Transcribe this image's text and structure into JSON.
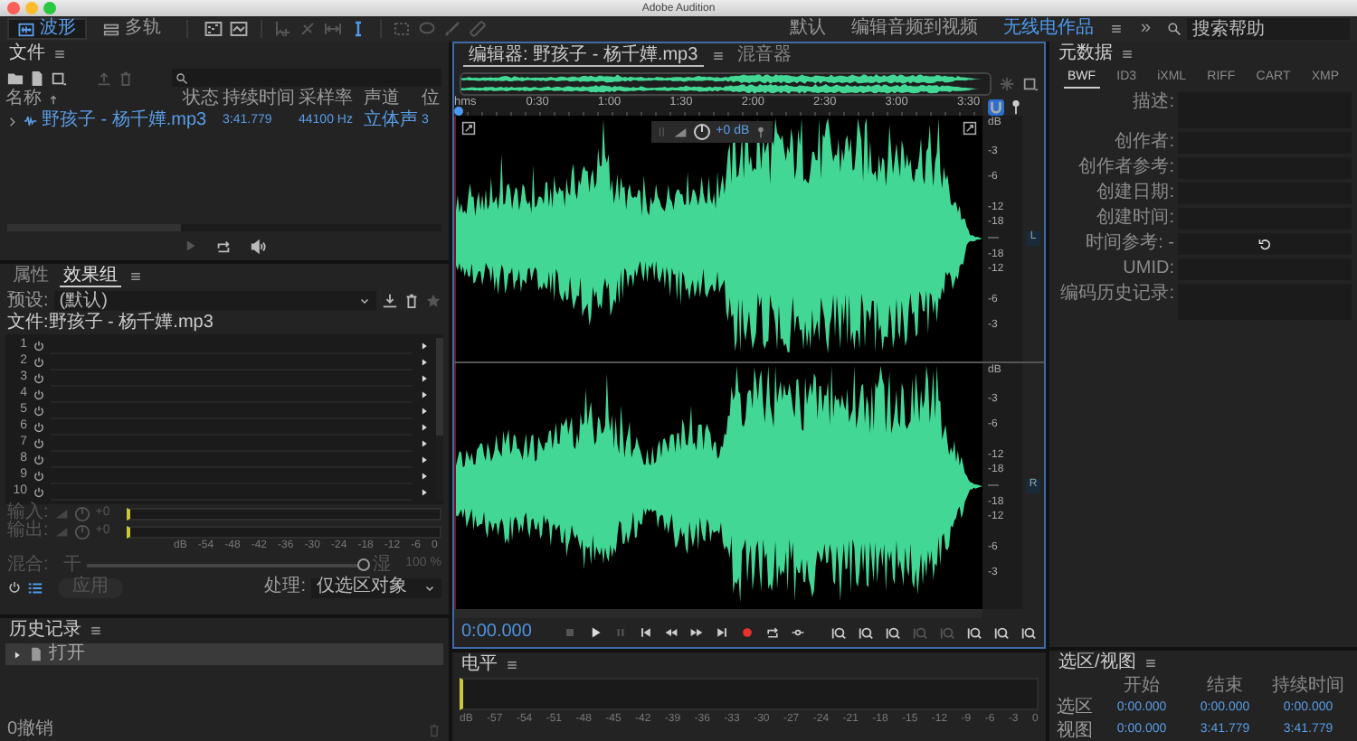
{
  "window": {
    "title": "Adobe Audition"
  },
  "toolbar": {
    "views": [
      {
        "label": "波形",
        "kind": "waveform",
        "selected": true
      },
      {
        "label": "多轨",
        "kind": "multitrack",
        "selected": false
      }
    ],
    "tools": [
      {
        "kind": "spectral",
        "selected": false,
        "disabled": false
      },
      {
        "kind": "pitch",
        "selected": false,
        "disabled": false
      },
      {
        "kind": "move",
        "selected": false,
        "disabled": true
      },
      {
        "kind": "razor",
        "selected": false,
        "disabled": true
      },
      {
        "kind": "slip",
        "selected": false,
        "disabled": true
      },
      {
        "kind": "time",
        "selected": true,
        "disabled": false
      },
      {
        "kind": "marquee",
        "selected": false,
        "disabled": true
      },
      {
        "kind": "lasso",
        "selected": false,
        "disabled": true
      },
      {
        "kind": "brush",
        "selected": false,
        "disabled": true
      },
      {
        "kind": "healing",
        "selected": false,
        "disabled": true
      }
    ],
    "workspaces": [
      {
        "label": "默认",
        "selected": false
      },
      {
        "label": "编辑音频到视频",
        "selected": false
      },
      {
        "label": "无线电作品",
        "selected": true
      }
    ],
    "overflow": "»",
    "search": {
      "placeholder": "搜索帮助"
    }
  },
  "files_panel": {
    "title": "文件",
    "columns": [
      "名称",
      "状态",
      "持续时间",
      "采样率",
      "声道",
      "位"
    ],
    "rows": [
      {
        "name": "野孩子 - 杨千嬅.mp3",
        "duration": "3:41.779",
        "sample_rate": "44100 Hz",
        "channels": "立体声",
        "column_6": "3"
      }
    ]
  },
  "effects_panel": {
    "tabs": [
      {
        "label": "属性",
        "selected": false
      },
      {
        "label": "效果组",
        "selected": true
      }
    ],
    "preset_label": "预设:",
    "preset": "(默认)",
    "file_label": "文件:野孩子 - 杨千嬅.mp3",
    "slots": [
      "1",
      "2",
      "3",
      "4",
      "5",
      "6",
      "7",
      "8",
      "9",
      "10"
    ],
    "io": [
      {
        "label": "输入:",
        "value": "+0"
      },
      {
        "label": "输出:",
        "value": "+0"
      }
    ],
    "meter_scale": [
      "dB",
      "-54",
      "-48",
      "-42",
      "-36",
      "-30",
      "-24",
      "-18",
      "-12",
      "-6",
      "0"
    ],
    "mix": {
      "label": "混合:",
      "dry": "干",
      "wet": "湿",
      "level": 1,
      "reading": "100 %"
    },
    "apply": "应用",
    "process_label": "处理:",
    "process": "仅选区对象"
  },
  "history_panel": {
    "title": "历史记录",
    "items": [
      {
        "label": "打开",
        "selected": true
      }
    ],
    "status": "0撤销"
  },
  "editor": {
    "tabs": [
      {
        "label": "编辑器: 野孩子 - 杨千嬅.mp3",
        "selected": true
      },
      {
        "label": "混音器",
        "selected": false
      }
    ],
    "ruler": [
      "hms",
      "0:30",
      "1:00",
      "1:30",
      "2:00",
      "2:30",
      "3:00",
      "3:30"
    ],
    "snapping": true,
    "hud": "+0 dB",
    "channels": [
      {
        "label": "L",
        "scale": [
          "dB",
          "-3",
          "-6",
          "-12",
          "-18",
          "—",
          "-18",
          "-12",
          "-6",
          "-3"
        ]
      },
      {
        "label": "R",
        "scale": [
          "dB",
          "-3",
          "-6",
          "-12",
          "-18",
          "—",
          "-18",
          "-12",
          "-6",
          "-3"
        ]
      }
    ],
    "time": "0:00.000"
  },
  "levels_panel": {
    "title": "电平",
    "scale": [
      "dB",
      "-57",
      "-54",
      "-51",
      "-48",
      "-45",
      "-42",
      "-39",
      "-36",
      "-33",
      "-30",
      "-27",
      "-24",
      "-21",
      "-18",
      "-15",
      "-12",
      "-9",
      "-6",
      "-3",
      "0"
    ]
  },
  "metadata_panel": {
    "title": "元数据",
    "tabs": [
      {
        "label": "BWF",
        "selected": true
      },
      {
        "label": "ID3",
        "selected": false
      },
      {
        "label": "iXML",
        "selected": false
      },
      {
        "label": "RIFF",
        "selected": false
      },
      {
        "label": "CART",
        "selected": false
      },
      {
        "label": "XMP",
        "selected": false
      }
    ],
    "fields": [
      {
        "label": "描述:",
        "kind": "area"
      },
      {
        "label": "创作者:",
        "kind": "line"
      },
      {
        "label": "创作者参考:",
        "kind": "line"
      },
      {
        "label": "创建日期:",
        "kind": "line"
      },
      {
        "label": "创建时间:",
        "kind": "line"
      },
      {
        "label": "时间参考: -",
        "kind": "time"
      },
      {
        "label": "UMID:",
        "kind": "line"
      },
      {
        "label": "编码历史记录:",
        "kind": "area"
      }
    ]
  },
  "selection_panel": {
    "title": "选区/视图",
    "columns": [
      "开始",
      "结束",
      "持续时间"
    ],
    "rows": [
      {
        "label": "选区",
        "values": [
          "0:00.000",
          "0:00.000",
          "0:00.000"
        ]
      },
      {
        "label": "视图",
        "values": [
          "0:00.000",
          "3:41.779",
          "3:41.779"
        ]
      }
    ]
  }
}
